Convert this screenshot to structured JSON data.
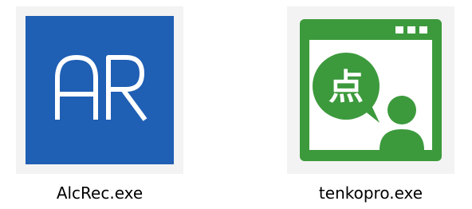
{
  "files": [
    {
      "name": "AlcRec.exe",
      "icon": "alcrec-app-icon",
      "icon_text": "AR",
      "icon_color": "#1f5fb4"
    },
    {
      "name": "tenkopro.exe",
      "icon": "tenkopro-app-icon",
      "icon_text": "点",
      "icon_color": "#3c9a3c"
    }
  ]
}
